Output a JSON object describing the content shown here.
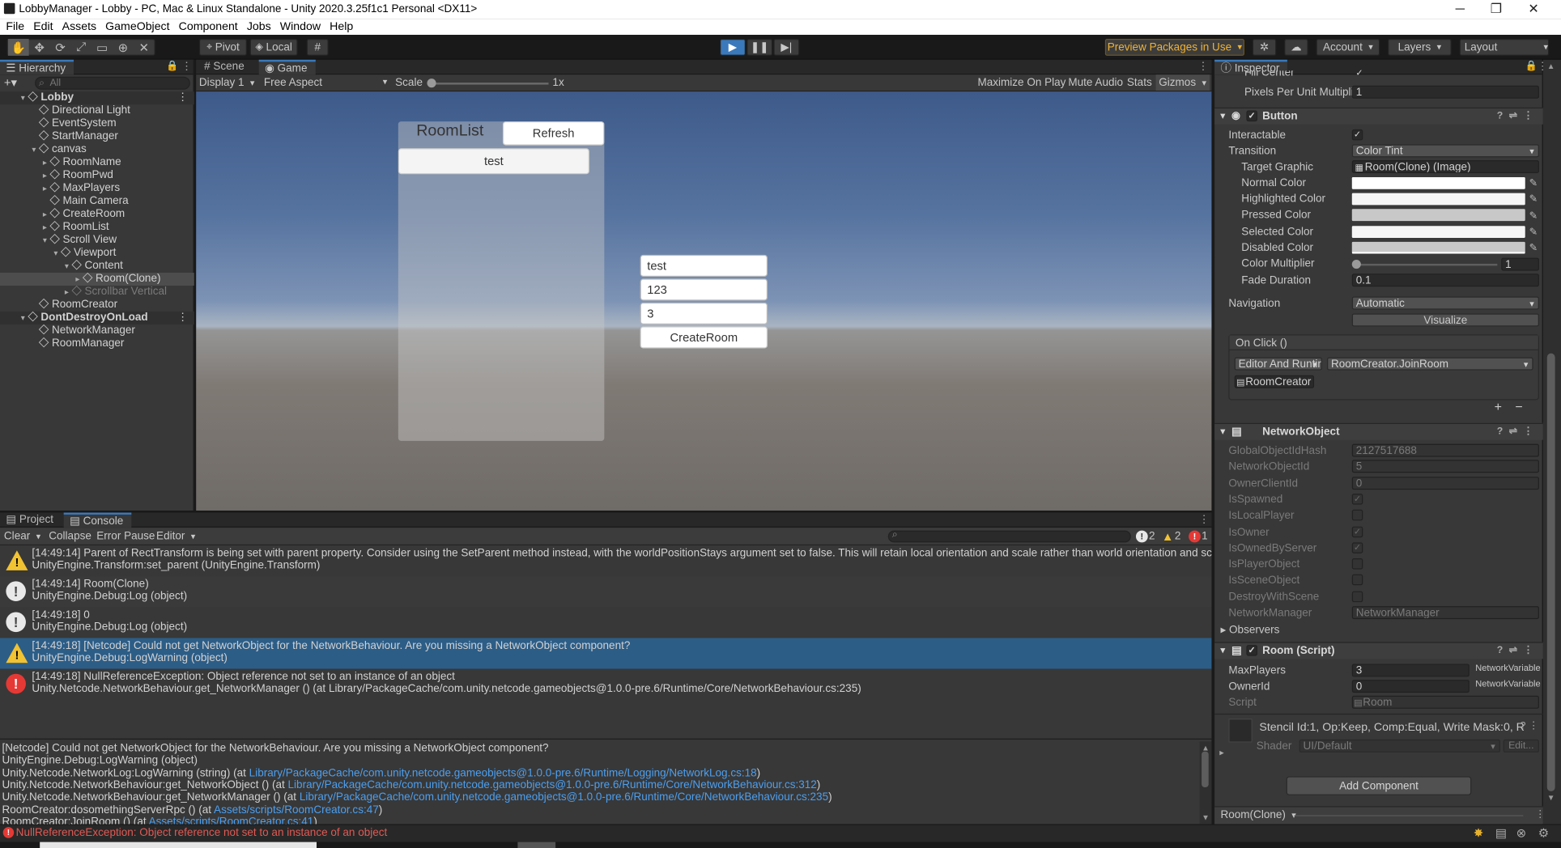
{
  "window": {
    "title": "LobbyManager - Lobby - PC, Mac & Linux Standalone - Unity 2020.3.25f1c1 Personal <DX11>",
    "minimize": "─",
    "maximize": "❐",
    "close": "✕"
  },
  "menu": [
    "File",
    "Edit",
    "Assets",
    "GameObject",
    "Component",
    "Jobs",
    "Window",
    "Help"
  ],
  "toolbar": {
    "pivot": "Pivot",
    "local": "Local",
    "preview_packages": "Preview Packages in Use",
    "account": "Account",
    "layers": "Layers",
    "layout": "Layout"
  },
  "hierarchy": {
    "tab": "Hierarchy",
    "search_placeholder": "All",
    "items": [
      {
        "label": "Lobby",
        "type": "scene"
      },
      {
        "label": "Directional Light"
      },
      {
        "label": "EventSystem"
      },
      {
        "label": "StartManager"
      },
      {
        "label": "canvas"
      },
      {
        "label": "RoomName"
      },
      {
        "label": "RoomPwd"
      },
      {
        "label": "MaxPlayers"
      },
      {
        "label": "Main Camera"
      },
      {
        "label": "CreateRoom"
      },
      {
        "label": "RoomList"
      },
      {
        "label": "Scroll View"
      },
      {
        "label": "Viewport"
      },
      {
        "label": "Content"
      },
      {
        "label": "Room(Clone)",
        "selected": true
      },
      {
        "label": "Scrollbar Vertical",
        "inactive": true
      },
      {
        "label": "RoomCreator"
      },
      {
        "label": "DontDestroyOnLoad",
        "type": "scene"
      },
      {
        "label": "NetworkManager"
      },
      {
        "label": "RoomManager"
      }
    ]
  },
  "scene_tabs": {
    "scene": "Scene",
    "game": "Game"
  },
  "game_toolbar": {
    "display": "Display 1",
    "aspect": "Free Aspect",
    "scale_label": "Scale",
    "scale_value": "1x",
    "maximize": "Maximize On Play",
    "mute": "Mute Audio",
    "stats": "Stats",
    "gizmos": "Gizmos"
  },
  "game": {
    "roomlist_title": "RoomList",
    "refresh": "Refresh",
    "room_item": "test",
    "room_name_value": "test",
    "room_pwd_value": "123",
    "max_players_value": "3",
    "create_room": "CreateRoom"
  },
  "inspector": {
    "tab": "Inspector",
    "fill_center": "Fill Center",
    "ppu_label": "Pixels Per Unit Multiplier",
    "ppu_value": "1",
    "button": {
      "title": "Button",
      "interactable": "Interactable",
      "transition_label": "Transition",
      "transition_value": "Color Tint",
      "target_graphic_label": "Target Graphic",
      "target_graphic_value": "Room(Clone) (Image)",
      "normal_color": "Normal Color",
      "highlighted_color": "Highlighted Color",
      "pressed_color": "Pressed Color",
      "selected_color": "Selected Color",
      "disabled_color": "Disabled Color",
      "color_multiplier": "Color Multiplier",
      "color_multiplier_value": "1",
      "fade_duration": "Fade Duration",
      "fade_duration_value": "0.1",
      "navigation_label": "Navigation",
      "navigation_value": "Automatic",
      "visualize": "Visualize",
      "onclick": "On Click ()",
      "runtime": "Editor And Runtime",
      "function": "RoomCreator.JoinRoom",
      "target": "RoomCreator",
      "plus": "+",
      "minus": "−"
    },
    "network_object": {
      "title": "NetworkObject",
      "fields": [
        {
          "label": "GlobalObjectIdHash",
          "value": "2127517688"
        },
        {
          "label": "NetworkObjectId",
          "value": "5"
        },
        {
          "label": "OwnerClientId",
          "value": "0"
        }
      ],
      "checks": [
        {
          "label": "IsSpawned",
          "checked": true
        },
        {
          "label": "IsLocalPlayer",
          "checked": false
        },
        {
          "label": "IsOwner",
          "checked": true
        },
        {
          "label": "IsOwnedByServer",
          "checked": true
        },
        {
          "label": "IsPlayerObject",
          "checked": false
        },
        {
          "label": "IsSceneObject",
          "checked": false
        },
        {
          "label": "DestroyWithScene",
          "checked": false
        }
      ],
      "network_manager_label": "NetworkManager",
      "network_manager_value": "NetworkManager",
      "observers": "Observers"
    },
    "room_script": {
      "title": "Room (Script)",
      "max_players_label": "MaxPlayers",
      "max_players_value": "3",
      "owner_id_label": "OwnerId",
      "owner_id_value": "0",
      "netvar": "NetworkVariable",
      "script_label": "Script",
      "script_value": "Room"
    },
    "material": {
      "stencil": "Stencil Id:1, Op:Keep, Comp:Equal, Write Mask:0, R",
      "shader_label": "Shader",
      "shader_value": "UI/Default",
      "edit": "Edit..."
    },
    "add_component": "Add Component",
    "footer": "Room(Clone)"
  },
  "console": {
    "project_tab": "Project",
    "console_tab": "Console",
    "clear": "Clear",
    "collapse": "Collapse",
    "error_pause": "Error Pause",
    "editor": "Editor",
    "count_info": "2",
    "count_warn": "2",
    "count_err": "1",
    "entries": [
      {
        "type": "warn",
        "line1": "[14:49:14] Parent of RectTransform is being set with parent property. Consider using the SetParent method instead, with the worldPositionStays argument set to false. This will retain local orientation and scale rather than world orientation and scale, which can pre",
        "line2": "UnityEngine.Transform:set_parent (UnityEngine.Transform)"
      },
      {
        "type": "info",
        "line1": "[14:49:14] Room(Clone)",
        "line2": "UnityEngine.Debug:Log (object)"
      },
      {
        "type": "info",
        "line1": "[14:49:18] 0",
        "line2": "UnityEngine.Debug:Log (object)"
      },
      {
        "type": "warn",
        "selected": true,
        "line1": "[14:49:18] [Netcode] Could not get NetworkObject for the NetworkBehaviour. Are you missing a NetworkObject component?",
        "line2": "UnityEngine.Debug:LogWarning (object)"
      },
      {
        "type": "err",
        "line1": "[14:49:18] NullReferenceException: Object reference not set to an instance of an object",
        "line2": "Unity.Netcode.NetworkBehaviour.get_NetworkManager () (at Library/PackageCache/com.unity.netcode.gameobjects@1.0.0-pre.6/Runtime/Core/NetworkBehaviour.cs:235)"
      }
    ],
    "detail": [
      {
        "text": "[Netcode] Could not get NetworkObject for the NetworkBehaviour. Are you missing a NetworkObject component?",
        "link": "",
        "tail": ""
      },
      {
        "text": "UnityEngine.Debug:LogWarning (object)",
        "link": "",
        "tail": ""
      },
      {
        "text": "Unity.Netcode.NetworkLog:LogWarning (string) (at ",
        "link": "Library/PackageCache/com.unity.netcode.gameobjects@1.0.0-pre.6/Runtime/Logging/NetworkLog.cs:18",
        "tail": ")"
      },
      {
        "text": "Unity.Netcode.NetworkBehaviour:get_NetworkObject () (at ",
        "link": "Library/PackageCache/com.unity.netcode.gameobjects@1.0.0-pre.6/Runtime/Core/NetworkBehaviour.cs:312",
        "tail": ")"
      },
      {
        "text": "Unity.Netcode.NetworkBehaviour:get_NetworkManager () (at ",
        "link": "Library/PackageCache/com.unity.netcode.gameobjects@1.0.0-pre.6/Runtime/Core/NetworkBehaviour.cs:235",
        "tail": ")"
      },
      {
        "text": "RoomCreator:dosomethingServerRpc () (at ",
        "link": "Assets/scripts/RoomCreator.cs:47",
        "tail": ")"
      },
      {
        "text": "RoomCreator:JoinRoom () (at ",
        "link": "Assets/scripts/RoomCreator.cs:41",
        "tail": ")"
      }
    ]
  },
  "status": {
    "error": "NullReferenceException: Object reference not set to an instance of an object"
  },
  "colors": {
    "accent": "#3a79bb",
    "selected_row": "#2c5d87",
    "link": "#4c9ff0",
    "error": "#e53935",
    "warning": "#f1c232"
  }
}
